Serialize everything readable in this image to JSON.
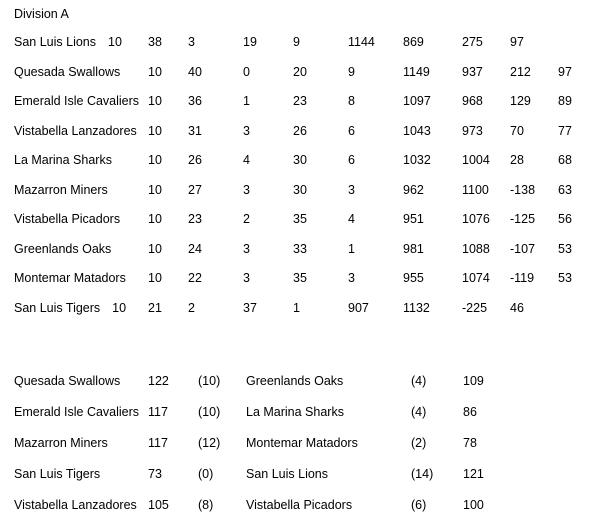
{
  "document": {
    "division_title": "Division A"
  },
  "standings": {
    "rows": [
      {
        "team": "San Luis Lions",
        "shifted": true,
        "values": [
          "10",
          "38",
          "3",
          "19",
          "9",
          "1144",
          "869",
          "275",
          "97",
          ""
        ]
      },
      {
        "team": "Quesada Swallows",
        "shifted": false,
        "values": [
          "10",
          "40",
          "0",
          "20",
          "9",
          "1149",
          "937",
          "212",
          "97"
        ]
      },
      {
        "team": "Emerald Isle Cavaliers",
        "shifted": false,
        "values": [
          "10",
          "36",
          "1",
          "23",
          "8",
          "1097",
          "968",
          "129",
          "89"
        ]
      },
      {
        "team": "Vistabella Lanzadores",
        "shifted": false,
        "values": [
          "10",
          "31",
          "3",
          "26",
          "6",
          "1043",
          "973",
          "70",
          "77"
        ]
      },
      {
        "team": "La Marina Sharks",
        "shifted": false,
        "values": [
          "10",
          "26",
          "4",
          "30",
          "6",
          "1032",
          "1004",
          "28",
          "68"
        ]
      },
      {
        "team": "Mazarron Miners",
        "shifted": false,
        "values": [
          "10",
          "27",
          "3",
          "30",
          "3",
          "962",
          "1100",
          "-138",
          "63"
        ]
      },
      {
        "team": "Vistabella Picadors",
        "shifted": false,
        "values": [
          "10",
          "23",
          "2",
          "35",
          "4",
          "951",
          "1076",
          "-125",
          "56"
        ]
      },
      {
        "team": "Greenlands Oaks",
        "shifted": false,
        "values": [
          "10",
          "24",
          "3",
          "33",
          "1",
          "981",
          "1088",
          "-107",
          "53"
        ]
      },
      {
        "team": "Montemar Matadors",
        "shifted": false,
        "values": [
          "10",
          "22",
          "3",
          "35",
          "3",
          "955",
          "1074",
          "-119",
          "53"
        ]
      },
      {
        "team": "San Luis Tigers",
        "shifted": true,
        "values": [
          "10",
          "21",
          "2",
          "37",
          "1",
          "907",
          "1132",
          "-225",
          "46",
          ""
        ]
      }
    ]
  },
  "results": {
    "rows": [
      {
        "home_team": "Quesada Swallows",
        "home_score": "122",
        "home_bonus": "(10)",
        "away_team": "Greenlands Oaks",
        "away_bonus": "(4)",
        "away_score": "109"
      },
      {
        "home_team": "Emerald Isle Cavaliers",
        "home_score": "117",
        "home_bonus": "(10)",
        "away_team": "La Marina Sharks",
        "away_bonus": "(4)",
        "away_score": "86"
      },
      {
        "home_team": "Mazarron Miners",
        "home_score": "117",
        "home_bonus": "(12)",
        "away_team": "Montemar Matadors",
        "away_bonus": "(2)",
        "away_score": "78"
      },
      {
        "home_team": "San Luis Tigers",
        "home_score": "73",
        "home_bonus": "(0)",
        "away_team": "San Luis Lions",
        "away_bonus": "(14)",
        "away_score": "121"
      },
      {
        "home_team": "Vistabella Lanzadores",
        "home_score": "105",
        "home_bonus": "(8)",
        "away_team": "Vistabella Picadors",
        "away_bonus": "(6)",
        "away_score": "100"
      }
    ]
  },
  "colors": {
    "text": "#000000",
    "background": "#ffffff"
  }
}
